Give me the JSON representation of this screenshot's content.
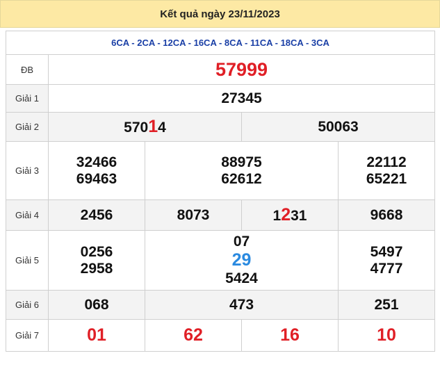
{
  "header": {
    "title": "Kết quả ngày 23/11/2023"
  },
  "codes": "6CA - 2CA - 12CA - 16CA - 8CA - 11CA - 18CA - 3CA",
  "labels": {
    "db": "ĐB",
    "g1": "Giải 1",
    "g2": "Giải 2",
    "g3": "Giải 3",
    "g4": "Giải 4",
    "g5": "Giải 5",
    "g6": "Giải 6",
    "g7": "Giải 7"
  },
  "prizes": {
    "db": "57999",
    "g1": "27345",
    "g2": [
      {
        "pre": "570",
        "hi": "1",
        "post": "4"
      },
      "50063"
    ],
    "g3": [
      "32466",
      "88975",
      "22112",
      "69463",
      "62612",
      "65221"
    ],
    "g4": [
      "2456",
      "8073",
      {
        "pre": "1",
        "hi": "2",
        "post": "31"
      },
      "9668"
    ],
    "g5": [
      "0256",
      {
        "pre": "07",
        "hi": "29"
      },
      "5497",
      "2958",
      "5424",
      "4777"
    ],
    "g6": [
      "068",
      "473",
      "251"
    ],
    "g7": [
      "01",
      "62",
      "16",
      "10"
    ]
  },
  "colors": {
    "header_bg": "#fde9a4",
    "codes": "#1a3fa6",
    "special": "#e01f26",
    "highlight_red": "#e01f26",
    "highlight_blue": "#2a8ae0"
  }
}
